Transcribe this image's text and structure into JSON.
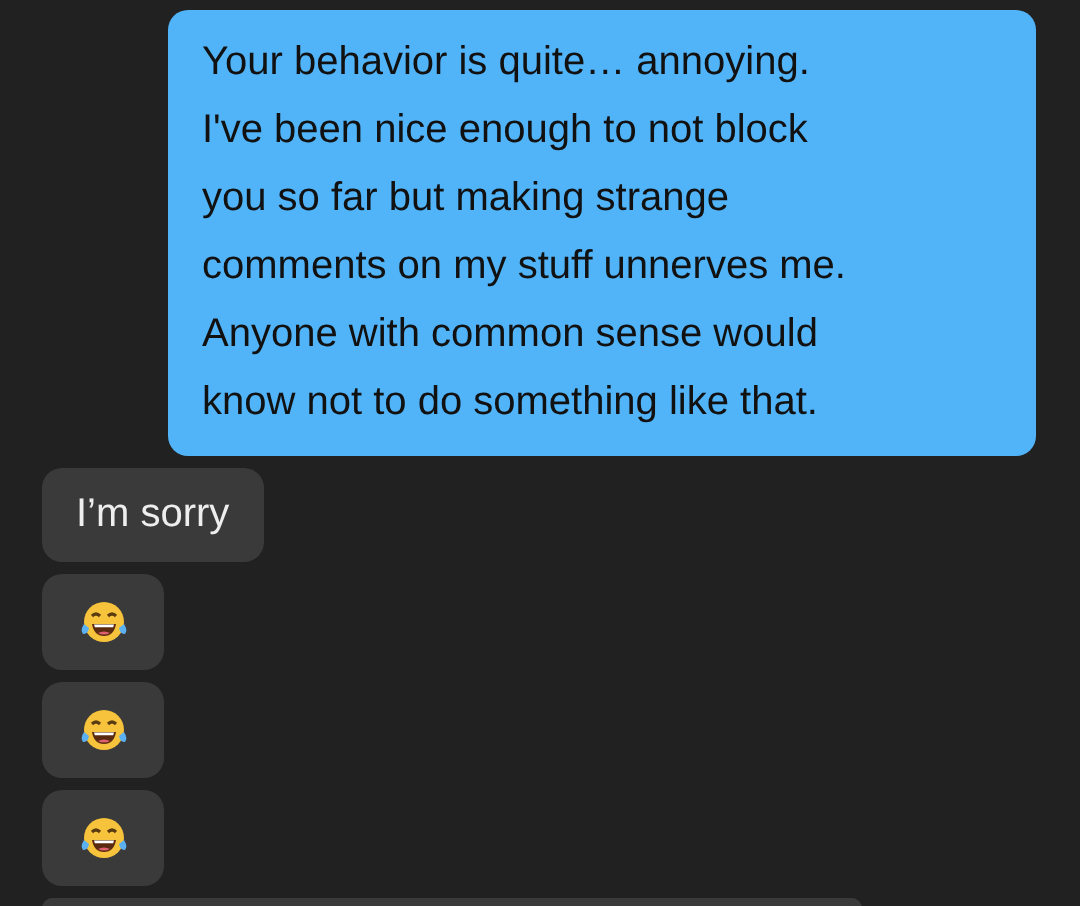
{
  "messages": [
    {
      "kind": "text",
      "outgoing": true,
      "text": "Your behavior is quite… annoying.\nI've been nice enough to not block\nyou so far but making strange\ncomments on my stuff unnerves me.\nAnyone with common sense would\nknow not to do something like that."
    },
    {
      "kind": "text",
      "outgoing": false,
      "text": "I’m sorry"
    },
    {
      "kind": "emoji",
      "outgoing": false
    },
    {
      "kind": "emoji",
      "outgoing": false
    },
    {
      "kind": "emoji",
      "outgoing": false
    },
    {
      "kind": "partial",
      "outgoing": false
    }
  ]
}
